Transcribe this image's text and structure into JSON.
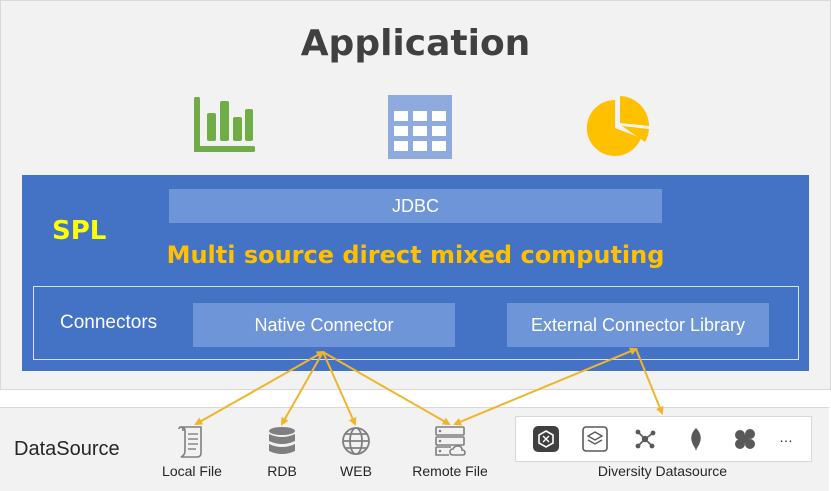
{
  "application": {
    "title": "Application",
    "icons": [
      "bar-chart-icon",
      "table-grid-icon",
      "pie-chart-icon"
    ]
  },
  "spl": {
    "label": "SPL",
    "jdbc": "JDBC",
    "tagline": "Multi source direct mixed computing",
    "connectors": {
      "label": "Connectors",
      "native": "Native Connector",
      "external": "External Connector Library"
    }
  },
  "datasource": {
    "label": "DataSource",
    "items": [
      {
        "label": "Local File",
        "icon": "scroll-file-icon"
      },
      {
        "label": "RDB",
        "icon": "database-icon"
      },
      {
        "label": "WEB",
        "icon": "globe-icon"
      },
      {
        "label": "Remote File",
        "icon": "remote-server-icon"
      },
      {
        "label": "Diversity Datasource",
        "icon": "datasource-group-icon"
      }
    ],
    "more": "…"
  },
  "colors": {
    "spl_blue": "#4472c4",
    "box_blue": "#6f95d9",
    "yellow": "#ffff00",
    "gold": "#ffc000",
    "green": "#70ad47",
    "arrow": "#f0b52a"
  }
}
